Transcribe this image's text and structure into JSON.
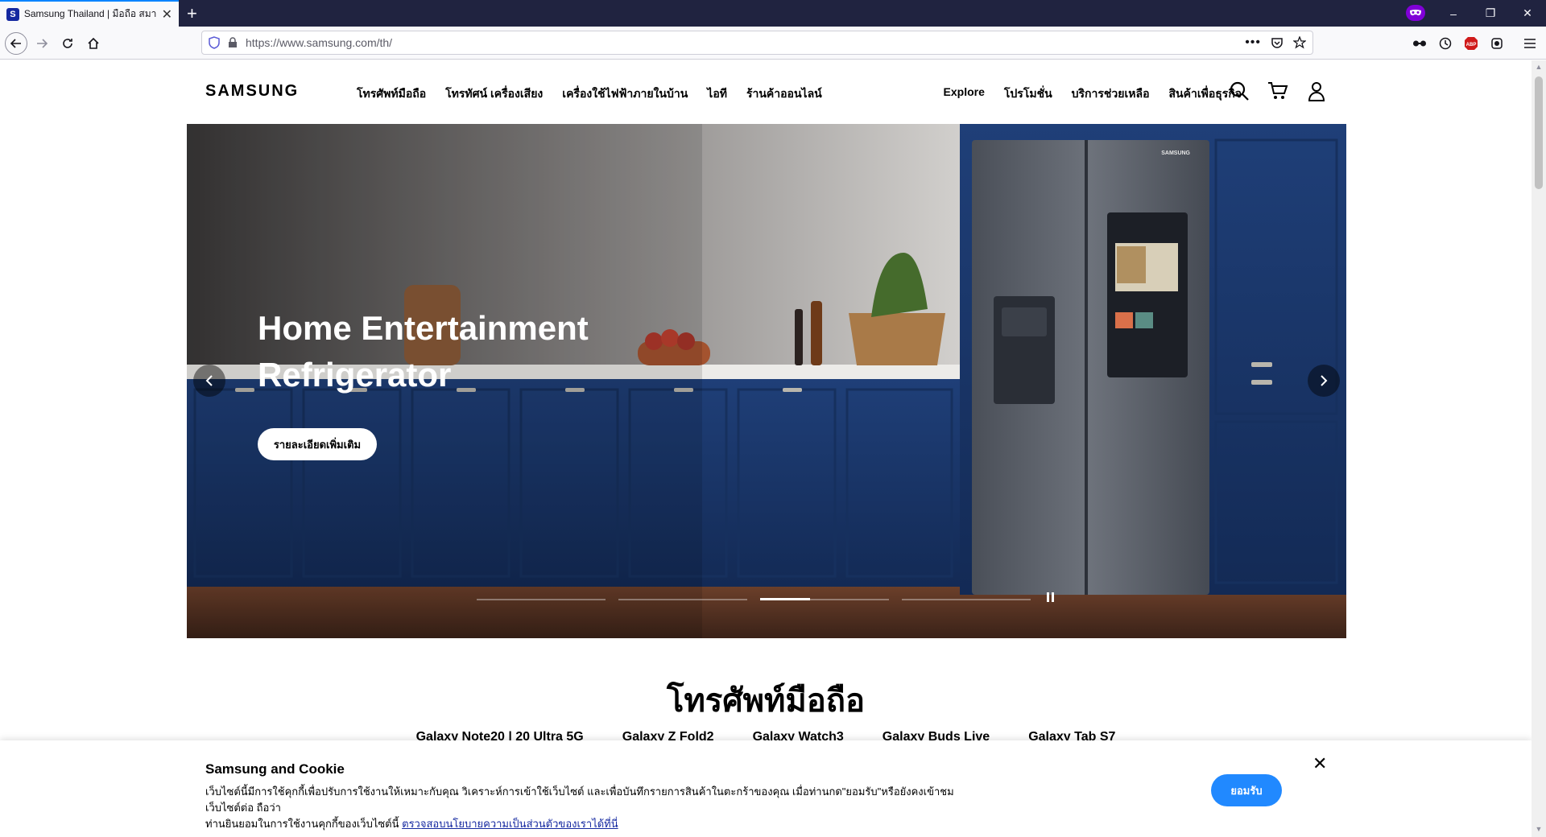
{
  "browser": {
    "tab_title": "Samsung Thailand | มือถือ สมาร์",
    "tab_favicon": "S",
    "url": "https://www.samsung.com/th/",
    "new_tab_label": "+",
    "window_controls": [
      "–",
      "❐",
      "✕"
    ]
  },
  "header": {
    "logo": "SAMSUNG",
    "main_nav": [
      "โทรศัพท์มือถือ",
      "โทรทัศน์ เครื่องเสียง",
      "เครื่องใช้ไฟฟ้าภายในบ้าน",
      "ไอที",
      "ร้านค้าออนไลน์"
    ],
    "sub_nav": [
      "Explore",
      "โปรโมชั่น",
      "บริการช่วยเหลือ",
      "สินค้าเพื่อธุรกิจ"
    ]
  },
  "hero": {
    "title": "Home Entertainment Refrigerator",
    "cta_label": "รายละเอียดเพิ่มเติม",
    "slide_count": 4,
    "active_slide": 3,
    "fridge_brand": "SAMSUNG"
  },
  "section": {
    "title": "โทรศัพท์มือถือ",
    "product_tabs": [
      "Galaxy Note20 | 20 Ultra 5G",
      "Galaxy Z Fold2",
      "Galaxy Watch3",
      "Galaxy Buds Live",
      "Galaxy Tab S7"
    ]
  },
  "cookie": {
    "title": "Samsung and Cookie",
    "text_line1": "เว็บไซต์นี้มีการใช้คุกกี้เพื่อปรับการใช้งานให้เหมาะกับคุณ วิเคราะห์การเข้าใช้เว็บไซต์ และเพื่อบันทึกรายการสินค้าในตะกร้าของคุณ เมื่อท่านกด\"ยอมรับ\"หรือยังคงเข้าชมเว็บไซต์ต่อ ถือว่า",
    "text_line2": "ท่านยินยอมในการใช้งานคุกกี้ของเว็บไซต์นี้ ",
    "link_text": "ตรวจสอบนโยบายความเป็นส่วนตัวของเราได้ที่นี่",
    "accept_label": "ยอมรับ",
    "close_label": "✕"
  },
  "colors": {
    "accent": "#2189ff",
    "brand_blue": "#1428a0",
    "tabstrip": "#202340"
  }
}
